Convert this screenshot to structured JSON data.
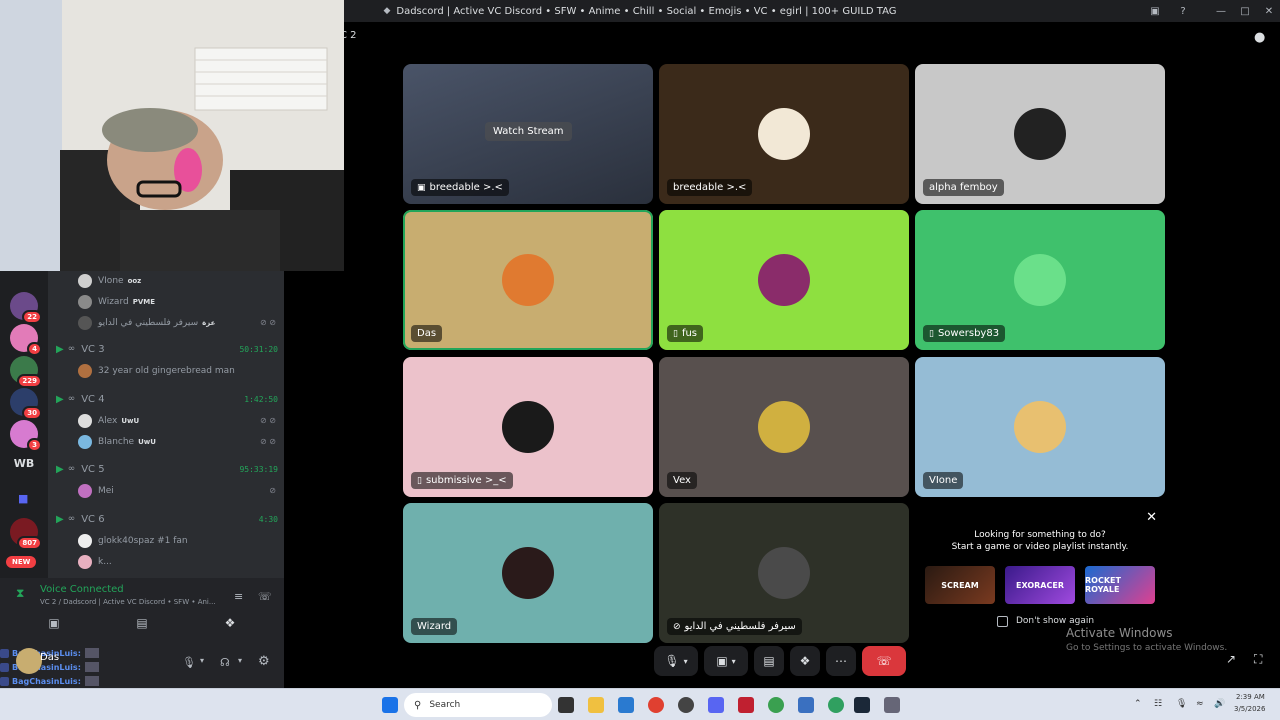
{
  "window": {
    "title": "Dadscord | Active VC Discord • SFW • Anime • Chill • Social • Emojis • VC • egirl | 100+ GUILD TAG",
    "vc_label": "C 2"
  },
  "guilds": {
    "badges": [
      "22",
      "4",
      "229",
      "30",
      "3",
      "807"
    ],
    "text_guild": "WB",
    "new_label": "NEW"
  },
  "channel_list": {
    "top_members": [
      {
        "name": "VIone",
        "tag": "ooz"
      },
      {
        "name": "Wizard",
        "tag": "PVME"
      },
      {
        "name": "سيرفر فلسطيني في الدايو",
        "tag": "عزة"
      }
    ],
    "channels": [
      {
        "name": "VC 3",
        "timer": "50:31:20",
        "members": [
          "32 year old gingerebread man"
        ]
      },
      {
        "name": "VC 4",
        "timer": "1:42:50",
        "members": [
          "Alex",
          "Blanche"
        ],
        "member_tags": [
          "UwU",
          "UwU"
        ]
      },
      {
        "name": "VC 5",
        "timer": "95:33:19",
        "members": [
          "Mei"
        ]
      },
      {
        "name": "VC 6",
        "timer": "4:30",
        "members": [
          "glokk40spaz #1 fan",
          "k..."
        ]
      }
    ]
  },
  "voice_panel": {
    "status": "Voice Connected",
    "location": "VC 2 / Dadscord | Active VC Discord • SFW • Ani..."
  },
  "user_panel": {
    "username": "Das",
    "chat_name": "BagChasinLuis",
    "chat_suffix": ":"
  },
  "tiles": [
    {
      "name": "breedable >.<",
      "kind": "stream",
      "action": "Watch Stream",
      "bg": "#3a4150"
    },
    {
      "name": "breedable >.<",
      "kind": "user",
      "bg": "#3b2a1a"
    },
    {
      "name": "alpha femboy",
      "kind": "user",
      "bg": "#c8c8c8"
    },
    {
      "name": "Das",
      "kind": "user",
      "bg": "#c8ad70",
      "speaking": true
    },
    {
      "name": "fus",
      "kind": "mobile",
      "bg": "#8ee040"
    },
    {
      "name": "Sowersby83",
      "kind": "mobile",
      "bg": "#3fc16c"
    },
    {
      "name": "submissive >_<",
      "kind": "mobile",
      "bg": "#ecc2cb"
    },
    {
      "name": "Vex",
      "kind": "user",
      "bg": "#58504e"
    },
    {
      "name": "VIone",
      "kind": "user",
      "bg": "#95bcd5"
    },
    {
      "name": "Wizard",
      "kind": "user",
      "bg": "#6fb0ad"
    },
    {
      "name": "سيرفر فلسطيني في الدايو",
      "kind": "muted",
      "bg": "#2e3128"
    }
  ],
  "activity": {
    "line1": "Looking for something to do?",
    "line2": "Start a game or video playlist instantly.",
    "games": [
      "SCREAM",
      "EXORACER",
      "ROCKET ROYALE"
    ],
    "dont_show": "Don't show again"
  },
  "activate_windows": {
    "title": "Activate Windows",
    "subtitle": "Go to Settings to activate Windows."
  },
  "taskbar": {
    "search_placeholder": "Search",
    "time": "2:39 AM",
    "date": "3/5/2026"
  }
}
